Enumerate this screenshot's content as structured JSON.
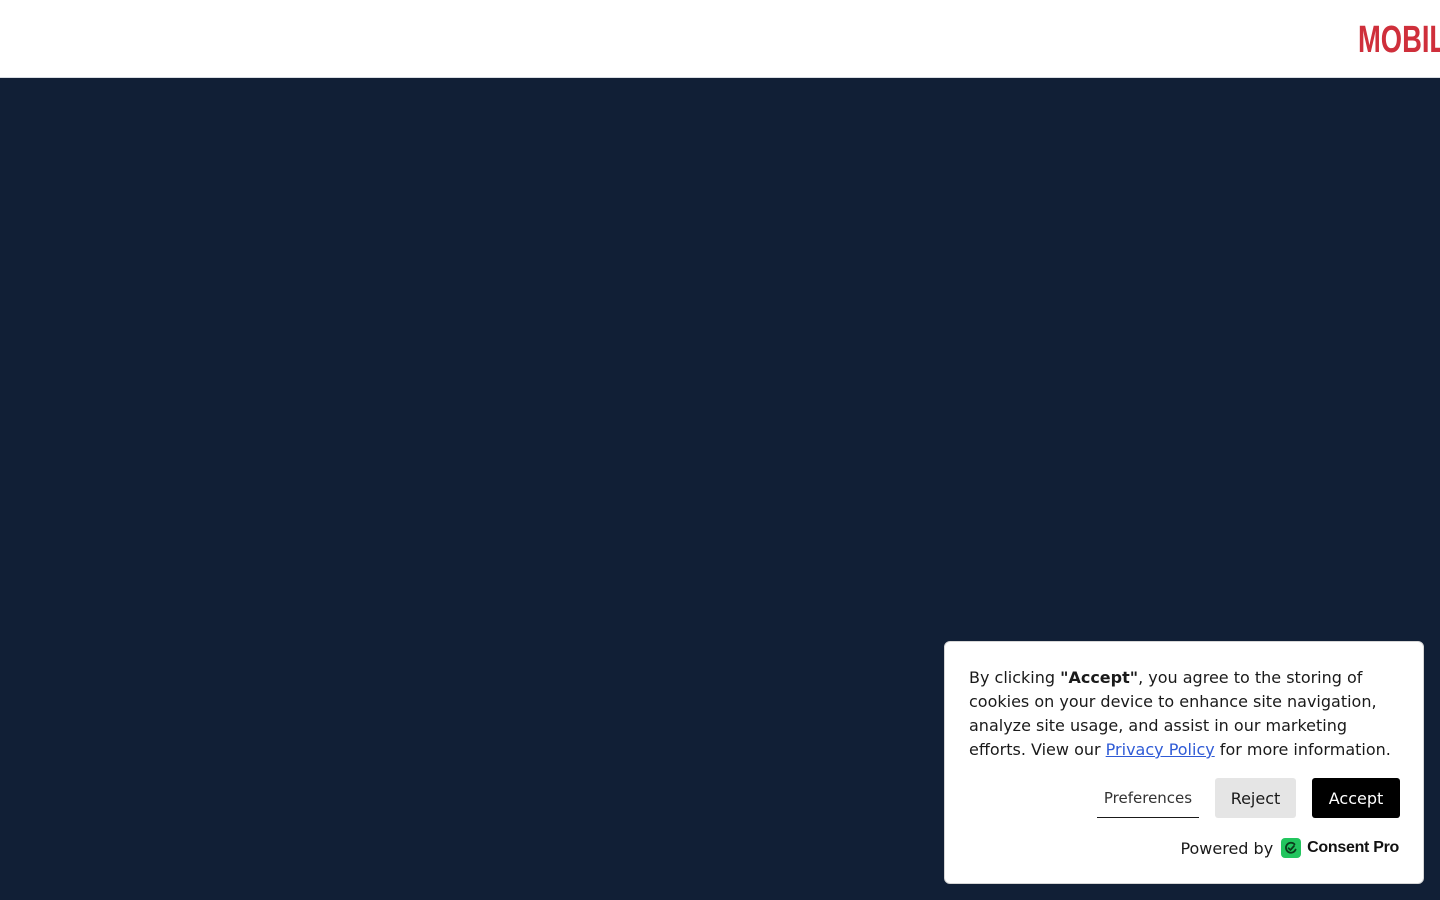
{
  "header": {
    "logo_text": "MOBIL",
    "logo_color": "#cf2f3b"
  },
  "hero": {
    "background_color": "#111f36"
  },
  "consent": {
    "text_prefix": "By clicking ",
    "text_bold": "\"Accept\"",
    "text_middle": ", you agree to the storing of cookies on your device to enhance site navigation, analyze site usage, and assist in our marketing efforts. View our ",
    "link_label": "Privacy Policy",
    "text_suffix": " for more information.",
    "preferences_label": "Preferences",
    "reject_label": "Reject",
    "accept_label": "Accept",
    "powered_by_label": "Powered by",
    "brand_name": "Consent Pro",
    "brand_icon": "consent-pro-check-icon",
    "brand_color": "#22c55e",
    "link_color": "#2f5bd6"
  }
}
